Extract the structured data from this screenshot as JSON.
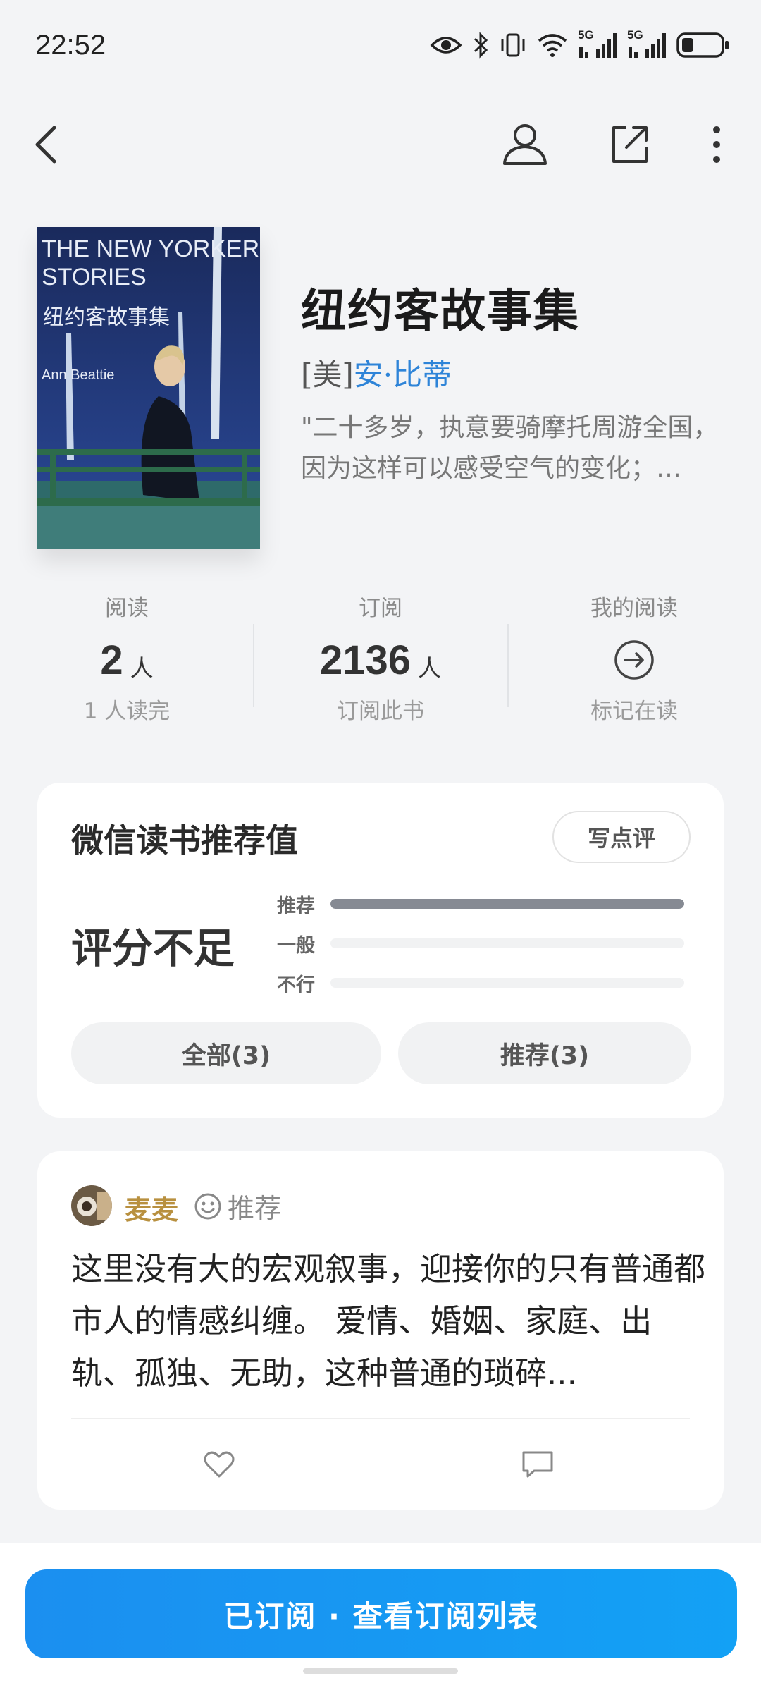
{
  "status_bar": {
    "time": "22:52",
    "signal_label_1": "5G",
    "signal_label_2": "5G"
  },
  "nav": {
    "back": "back-icon",
    "profile": "user-icon",
    "share": "share-icon",
    "more": "more-icon"
  },
  "book": {
    "cover_title_en": "THE NEW YORKER STORIES",
    "cover_title_en_line1": "THE NEW YORKER",
    "cover_title_en_line2": "STORIES",
    "cover_title_cn": "纽约客故事集",
    "cover_author": "Ann Beattie",
    "title": "纽约客故事集",
    "author_nationality": "[美]",
    "author_name": "安·比蒂",
    "intro": "\"二十多岁，执意要骑摩托周游全国，因为这样可以感受空气的变化；…"
  },
  "stats": [
    {
      "label": "阅读",
      "value": "2",
      "unit": "人",
      "sub": "1 人读完"
    },
    {
      "label": "订阅",
      "value": "2136",
      "unit": "人",
      "sub": "订阅此书"
    },
    {
      "label": "我的阅读",
      "sub": "标记在读",
      "icon": "arrow-right-circle-icon"
    }
  ],
  "rating": {
    "title": "微信读书推荐值",
    "write_review": "写点评",
    "score_text": "评分不足",
    "bars": [
      {
        "label": "推荐",
        "fraction": 1.0
      },
      {
        "label": "一般",
        "fraction": 0.0
      },
      {
        "label": "不行",
        "fraction": 0.0
      }
    ],
    "filters": [
      "全部(3)",
      "推荐(3)"
    ]
  },
  "review": {
    "user": "麦麦",
    "tag": "推荐",
    "text": "这里没有大的宏观叙事，迎接你的只有普通都市人的情感纠缠。 爱情、婚姻、家庭、出轨、孤独、无助，这种普通的琐碎..."
  },
  "bottom": {
    "button": "已订阅 · 查看订阅列表"
  },
  "colors": {
    "accent": "#1b8ff0",
    "author": "#2e84d8",
    "reviewer": "#b8903f",
    "background": "#f3f4f6"
  }
}
